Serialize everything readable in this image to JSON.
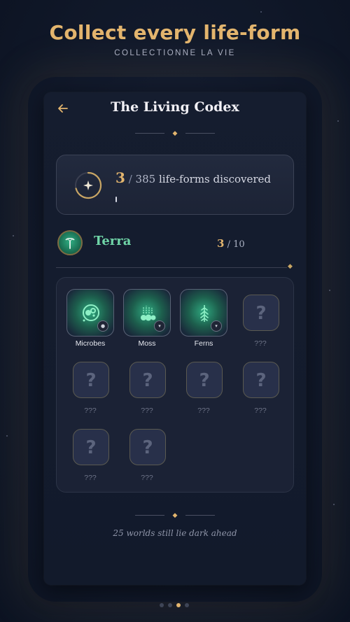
{
  "headline": "Collect every life-form",
  "subline": "COLLECTIONNE LA VIE",
  "screen": {
    "title": "The Living Codex",
    "progress": {
      "found": "3",
      "separator": "/",
      "total": "385",
      "suffix": "life-forms discovered",
      "fraction": 0.0078
    },
    "world": {
      "name": "Terra",
      "found": "3",
      "separator": "/",
      "total": "10"
    },
    "lifeforms": [
      {
        "name": "Microbes",
        "discovered": true,
        "icon": "microbe-icon"
      },
      {
        "name": "Moss",
        "discovered": true,
        "icon": "moss-icon"
      },
      {
        "name": "Ferns",
        "discovered": true,
        "icon": "fern-icon"
      },
      {
        "name": "???",
        "discovered": false
      },
      {
        "name": "???",
        "discovered": false
      },
      {
        "name": "???",
        "discovered": false
      },
      {
        "name": "???",
        "discovered": false
      },
      {
        "name": "???",
        "discovered": false
      },
      {
        "name": "???",
        "discovered": false
      },
      {
        "name": "???",
        "discovered": false
      }
    ],
    "locked_symbol": "?",
    "footer": "25 worlds still lie dark ahead"
  },
  "pager": {
    "count": 4,
    "active": 2
  },
  "colors": {
    "gold": "#e3b56e",
    "mint": "#6fd4a7",
    "background": "#121a2c"
  }
}
